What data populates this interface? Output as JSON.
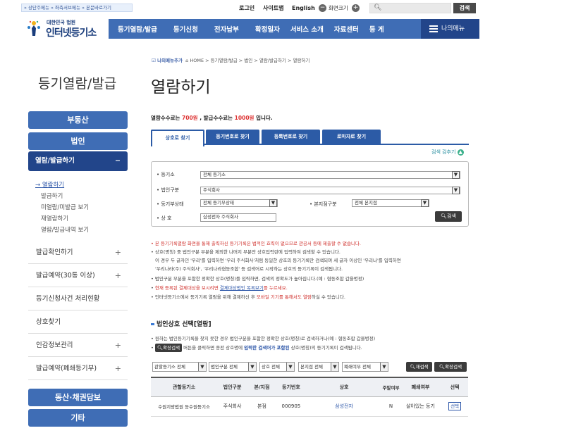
{
  "skip_links": "» 상단주메뉴  » 좌측서브메뉴  » 본문바로가기",
  "utility": {
    "login": "로그인",
    "sitemap": "사이트맵",
    "english": "English",
    "zoom_out_icon": "minus-circle",
    "zoom_label": "화면크기",
    "zoom_in_icon": "plus-circle",
    "search_placeholder": "",
    "search_button": "검색"
  },
  "logo": {
    "sub": "대한민국 법원",
    "main": "인터넷등기소"
  },
  "gnb": [
    "등기열람/발급",
    "등기신청",
    "전자납부",
    "확정일자",
    "서비스 소개",
    "자료센터",
    "등 게"
  ],
  "my_menu": "나의메뉴",
  "breadcrumb": {
    "fav": "나의메뉴추가",
    "path": "HOME > 등기열람/발급 > 법인 > 열람/발급하기 > 열람하기"
  },
  "side": {
    "title": "등기열람/발급",
    "realestate": "부동산",
    "corp": "법인",
    "section_active": "열람/발급하기",
    "sub": [
      "열람하기",
      "발급하기",
      "미열람/미발급 보기",
      "재열람하기",
      "열람/발급내역 보기"
    ],
    "items": [
      "발급확인하기",
      "발급예약(30통 이상)",
      "등기신청사건 처리현황",
      "상호찾기",
      "인감정보관리",
      "발급예약(폐쇄등기부)"
    ],
    "bottom": [
      "동산·채권담보",
      "기타"
    ]
  },
  "page_title": "열람하기",
  "fee": {
    "pre": "열람수수료는 ",
    "view_fee": "700원",
    "mid": " , 발급수수료는 ",
    "issue_fee": "1000원",
    "post": " 입니다."
  },
  "tabs": [
    "상호로 찾기",
    "등기번호로 찾기",
    "등록번호로 찾기",
    "로마자로 찾기"
  ],
  "collapse": "검색 감추기",
  "form": {
    "registry_label": "등기소",
    "registry_value": "전체 등기소",
    "corp_type_label": "법인구분",
    "corp_type_value": "주식회사",
    "status_label": "등기부상태",
    "status_value": "전체 등기부상태",
    "branch_label": "본지점구분",
    "branch_value": "전체 본지점",
    "name_label": "상 호",
    "name_value": "삼성전자 주식회사",
    "search_button": "검색"
  },
  "notes": [
    "본 등기기록열람 화면을 통해 출력하신 등기기록은 법적인 효력이 없으므로 관공서 등에 제출할 수 없습니다.",
    "상호(명칭) 중 법인구분 부분을 제외한 나머지 부분만 상호입력란에 입력하여 검색할 수 있습니다.",
    "이 경우 두 글자인 '우리'를 입력하면 '우리 주식회사'처럼 동일한 상호의 등기기록만 검색되며 세 글자 이상인 '우리나'를 입력하면",
    "'우리나라(주) 주식회사', '우리나라협동조합' 등 검색어로 시작하는 상호의 등기기록이 검색됩니다.",
    "법인구분 부분을 포함한 정확한 상호(명칭)를 입력하면, 검색의 정확도가 높아집니다.(예 : 협동조합 갑을병정)"
  ],
  "note_settle": {
    "pre": "현재 등록된 결제대상을 보시려면 ",
    "link": "결제대상법인 목록보기",
    "post": "를 누르세요."
  },
  "note_mobile": {
    "pre": "인터넷등기소에서 등기기록 열람을 위해 결제하신 후 ",
    "mid": "모바일 기기를 통해서도 열람",
    "post": "하실 수 있습니다."
  },
  "section": {
    "title": "법인상호 선택[열람]",
    "line1": "원하는 법인등기기록을 찾지 못한 경우 법인구분을 포함한 정확한 상호(명칭)로 검색하거나(예 : 협동조합 갑을병정)",
    "btn": "확장검색",
    "line2_pre": " 버튼을 클릭하면 종전 상호명에 ",
    "line2_mid": "입력한 검색어가 포함된",
    "line2_post": " 상호(명칭)의 등기기록이 검색됩니다."
  },
  "filters": {
    "f1": "관할등기소 전체",
    "f2": "법인구분 전체",
    "f3": "상호 전체",
    "f4": "본지점 전체",
    "f5": "폐쇄여부 전체",
    "re_search": "재검색",
    "ext_search": "확장검색"
  },
  "table": {
    "headers": [
      "관할등기소",
      "법인구분",
      "본/지점",
      "등기번호",
      "상호",
      "주말여부",
      "폐쇄여부",
      "선택"
    ],
    "rows": [
      [
        "수원지방법원 동수원등기소",
        "주식회사",
        "본점",
        "000905",
        "삼성전자",
        "N",
        "살아있는 등기",
        "선택"
      ]
    ]
  }
}
